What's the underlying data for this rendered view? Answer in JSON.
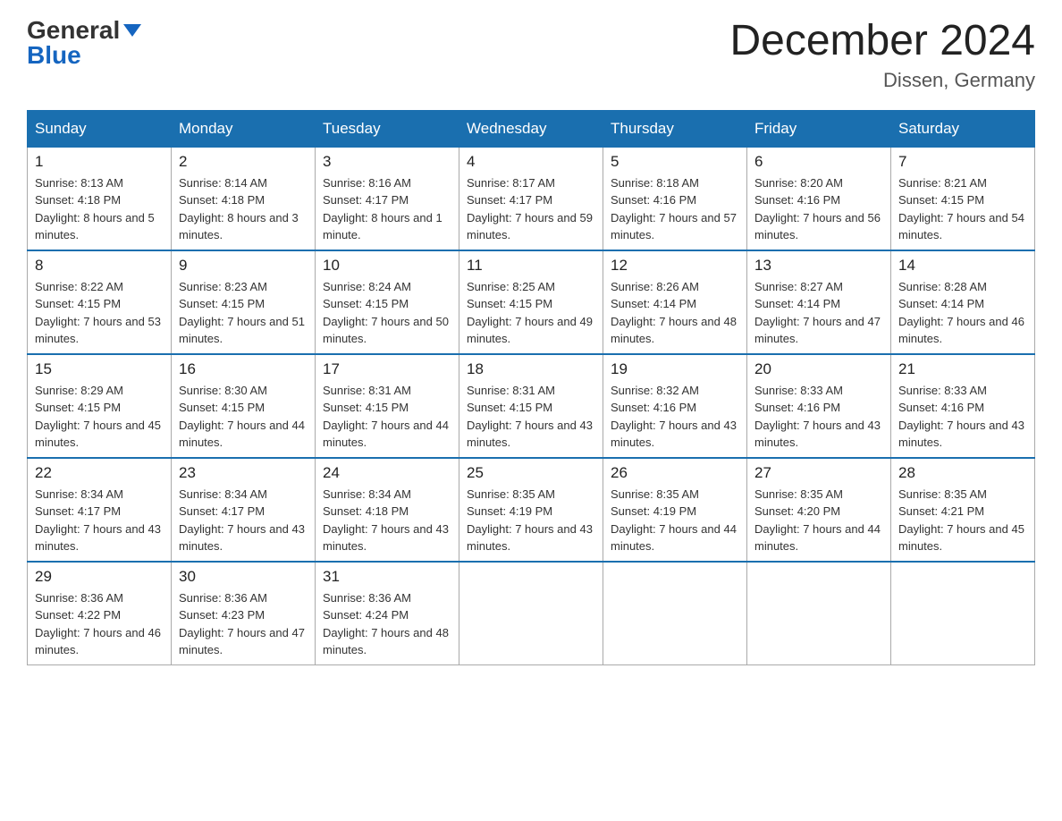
{
  "logo": {
    "general": "General",
    "blue": "Blue"
  },
  "header": {
    "title": "December 2024",
    "subtitle": "Dissen, Germany"
  },
  "days_of_week": [
    "Sunday",
    "Monday",
    "Tuesday",
    "Wednesday",
    "Thursday",
    "Friday",
    "Saturday"
  ],
  "weeks": [
    [
      {
        "day": "1",
        "sunrise": "8:13 AM",
        "sunset": "4:18 PM",
        "daylight": "8 hours and 5 minutes."
      },
      {
        "day": "2",
        "sunrise": "8:14 AM",
        "sunset": "4:18 PM",
        "daylight": "8 hours and 3 minutes."
      },
      {
        "day": "3",
        "sunrise": "8:16 AM",
        "sunset": "4:17 PM",
        "daylight": "8 hours and 1 minute."
      },
      {
        "day": "4",
        "sunrise": "8:17 AM",
        "sunset": "4:17 PM",
        "daylight": "7 hours and 59 minutes."
      },
      {
        "day": "5",
        "sunrise": "8:18 AM",
        "sunset": "4:16 PM",
        "daylight": "7 hours and 57 minutes."
      },
      {
        "day": "6",
        "sunrise": "8:20 AM",
        "sunset": "4:16 PM",
        "daylight": "7 hours and 56 minutes."
      },
      {
        "day": "7",
        "sunrise": "8:21 AM",
        "sunset": "4:15 PM",
        "daylight": "7 hours and 54 minutes."
      }
    ],
    [
      {
        "day": "8",
        "sunrise": "8:22 AM",
        "sunset": "4:15 PM",
        "daylight": "7 hours and 53 minutes."
      },
      {
        "day": "9",
        "sunrise": "8:23 AM",
        "sunset": "4:15 PM",
        "daylight": "7 hours and 51 minutes."
      },
      {
        "day": "10",
        "sunrise": "8:24 AM",
        "sunset": "4:15 PM",
        "daylight": "7 hours and 50 minutes."
      },
      {
        "day": "11",
        "sunrise": "8:25 AM",
        "sunset": "4:15 PM",
        "daylight": "7 hours and 49 minutes."
      },
      {
        "day": "12",
        "sunrise": "8:26 AM",
        "sunset": "4:14 PM",
        "daylight": "7 hours and 48 minutes."
      },
      {
        "day": "13",
        "sunrise": "8:27 AM",
        "sunset": "4:14 PM",
        "daylight": "7 hours and 47 minutes."
      },
      {
        "day": "14",
        "sunrise": "8:28 AM",
        "sunset": "4:14 PM",
        "daylight": "7 hours and 46 minutes."
      }
    ],
    [
      {
        "day": "15",
        "sunrise": "8:29 AM",
        "sunset": "4:15 PM",
        "daylight": "7 hours and 45 minutes."
      },
      {
        "day": "16",
        "sunrise": "8:30 AM",
        "sunset": "4:15 PM",
        "daylight": "7 hours and 44 minutes."
      },
      {
        "day": "17",
        "sunrise": "8:31 AM",
        "sunset": "4:15 PM",
        "daylight": "7 hours and 44 minutes."
      },
      {
        "day": "18",
        "sunrise": "8:31 AM",
        "sunset": "4:15 PM",
        "daylight": "7 hours and 43 minutes."
      },
      {
        "day": "19",
        "sunrise": "8:32 AM",
        "sunset": "4:16 PM",
        "daylight": "7 hours and 43 minutes."
      },
      {
        "day": "20",
        "sunrise": "8:33 AM",
        "sunset": "4:16 PM",
        "daylight": "7 hours and 43 minutes."
      },
      {
        "day": "21",
        "sunrise": "8:33 AM",
        "sunset": "4:16 PM",
        "daylight": "7 hours and 43 minutes."
      }
    ],
    [
      {
        "day": "22",
        "sunrise": "8:34 AM",
        "sunset": "4:17 PM",
        "daylight": "7 hours and 43 minutes."
      },
      {
        "day": "23",
        "sunrise": "8:34 AM",
        "sunset": "4:17 PM",
        "daylight": "7 hours and 43 minutes."
      },
      {
        "day": "24",
        "sunrise": "8:34 AM",
        "sunset": "4:18 PM",
        "daylight": "7 hours and 43 minutes."
      },
      {
        "day": "25",
        "sunrise": "8:35 AM",
        "sunset": "4:19 PM",
        "daylight": "7 hours and 43 minutes."
      },
      {
        "day": "26",
        "sunrise": "8:35 AM",
        "sunset": "4:19 PM",
        "daylight": "7 hours and 44 minutes."
      },
      {
        "day": "27",
        "sunrise": "8:35 AM",
        "sunset": "4:20 PM",
        "daylight": "7 hours and 44 minutes."
      },
      {
        "day": "28",
        "sunrise": "8:35 AM",
        "sunset": "4:21 PM",
        "daylight": "7 hours and 45 minutes."
      }
    ],
    [
      {
        "day": "29",
        "sunrise": "8:36 AM",
        "sunset": "4:22 PM",
        "daylight": "7 hours and 46 minutes."
      },
      {
        "day": "30",
        "sunrise": "8:36 AM",
        "sunset": "4:23 PM",
        "daylight": "7 hours and 47 minutes."
      },
      {
        "day": "31",
        "sunrise": "8:36 AM",
        "sunset": "4:24 PM",
        "daylight": "7 hours and 48 minutes."
      },
      null,
      null,
      null,
      null
    ]
  ],
  "labels": {
    "sunrise": "Sunrise: ",
    "sunset": "Sunset: ",
    "daylight": "Daylight: "
  }
}
